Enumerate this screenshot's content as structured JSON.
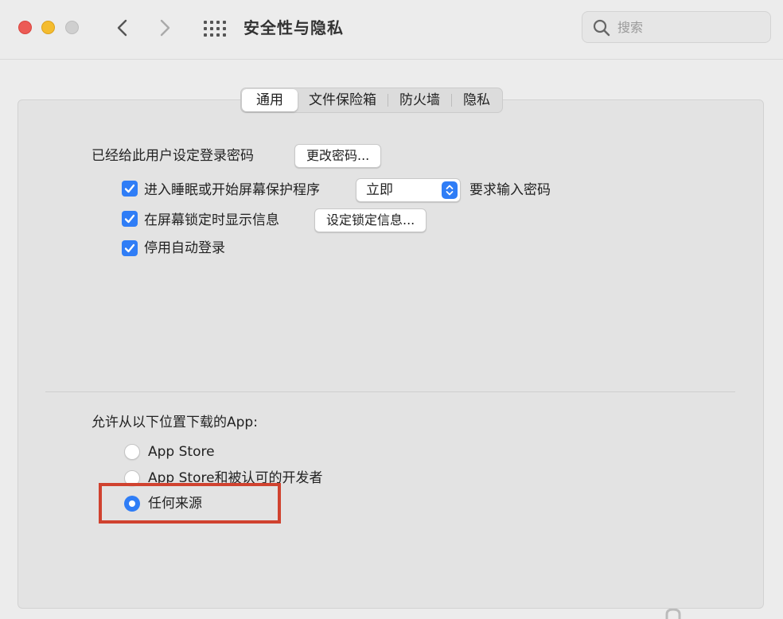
{
  "window": {
    "title": "安全性与隐私"
  },
  "search": {
    "placeholder": "搜索"
  },
  "tabs": [
    {
      "label": "通用",
      "active": true
    },
    {
      "label": "文件保险箱",
      "active": false
    },
    {
      "label": "防火墙",
      "active": false
    },
    {
      "label": "隐私",
      "active": false
    }
  ],
  "general": {
    "password_set_label": "已经给此用户设定登录密码",
    "change_password_button": "更改密码...",
    "require_password": {
      "checked": true,
      "label": "进入睡眠或开始屏幕保护程序",
      "delay_value": "立即",
      "suffix": "要求输入密码"
    },
    "lock_message": {
      "checked": true,
      "label": "在屏幕锁定时显示信息",
      "button": "设定锁定信息..."
    },
    "disable_autologin": {
      "checked": true,
      "label": "停用自动登录"
    }
  },
  "downloads": {
    "heading": "允许从以下位置下载的App:",
    "options": [
      {
        "label": "App Store",
        "selected": false
      },
      {
        "label": "App Store和被认可的开发者",
        "selected": false
      },
      {
        "label": "任何来源",
        "selected": true
      }
    ]
  },
  "colors": {
    "accent": "#2f7df6",
    "highlight": "#d0422f"
  }
}
